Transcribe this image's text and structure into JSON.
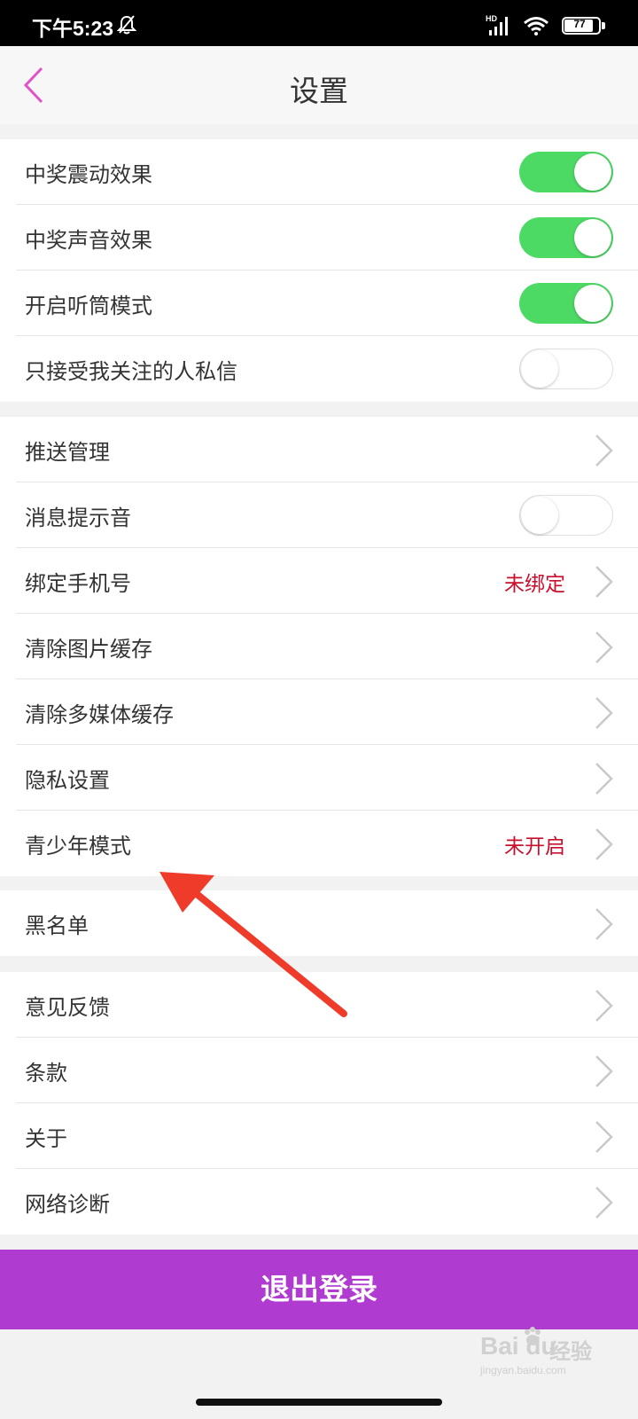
{
  "status_bar": {
    "time": "下午5:23",
    "signal_label": "HD",
    "battery": "77"
  },
  "header": {
    "title": "设置"
  },
  "groups": [
    {
      "rows": [
        {
          "label": "中奖震动效果",
          "control": "toggle",
          "on": true
        },
        {
          "label": "中奖声音效果",
          "control": "toggle",
          "on": true
        },
        {
          "label": "开启听筒模式",
          "control": "toggle",
          "on": true
        },
        {
          "label": "只接受我关注的人私信",
          "control": "toggle",
          "on": false
        }
      ]
    },
    {
      "rows": [
        {
          "label": "推送管理",
          "control": "chevron"
        },
        {
          "label": "消息提示音",
          "control": "toggle",
          "on": false
        },
        {
          "label": "绑定手机号",
          "control": "chevron",
          "value": "未绑定"
        },
        {
          "label": "清除图片缓存",
          "control": "chevron"
        },
        {
          "label": "清除多媒体缓存",
          "control": "chevron"
        },
        {
          "label": "隐私设置",
          "control": "chevron"
        },
        {
          "label": "青少年模式",
          "control": "chevron",
          "value": "未开启"
        }
      ]
    },
    {
      "rows": [
        {
          "label": "黑名单",
          "control": "chevron"
        }
      ]
    },
    {
      "rows": [
        {
          "label": "意见反馈",
          "control": "chevron"
        },
        {
          "label": "条款",
          "control": "chevron"
        },
        {
          "label": "关于",
          "control": "chevron"
        },
        {
          "label": "网络诊断",
          "control": "chevron"
        }
      ]
    }
  ],
  "logout_label": "退出登录",
  "watermark": {
    "brand": "Bai du",
    "cn": "经验",
    "url": "jingyan.baidu.com"
  },
  "colors": {
    "accent_purple": "#b03bd0",
    "toggle_on": "#4cd964",
    "value_red": "#c8102e",
    "back_pink": "#e052c8",
    "annotation_arrow": "#ee3b2a"
  }
}
